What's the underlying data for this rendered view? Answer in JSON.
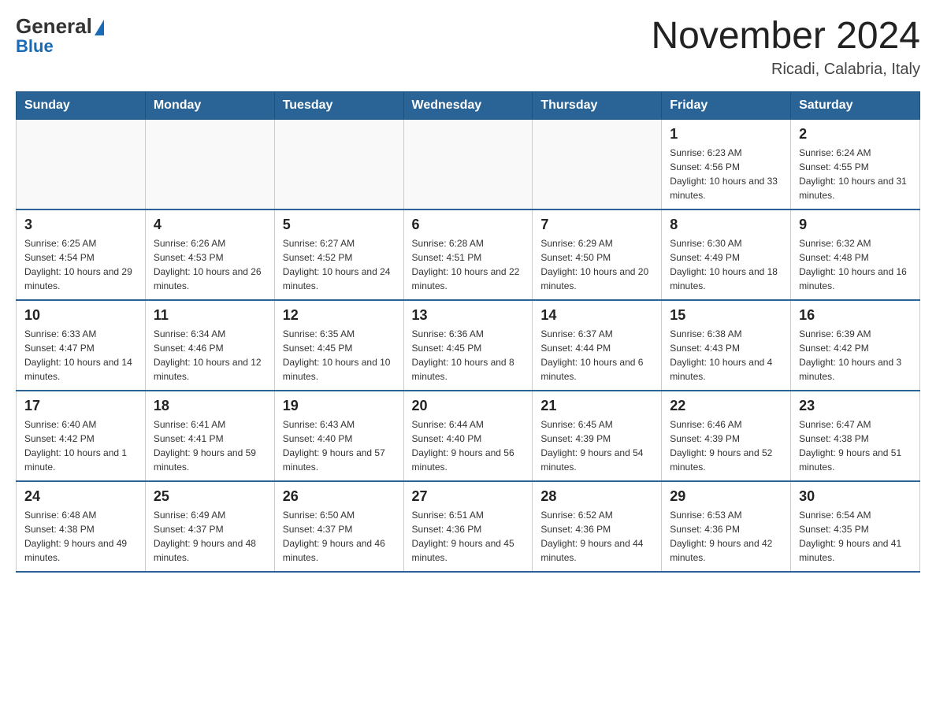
{
  "header": {
    "logo": {
      "general": "General",
      "triangle": "▶",
      "blue": "Blue"
    },
    "title": "November 2024",
    "location": "Ricadi, Calabria, Italy"
  },
  "days_of_week": [
    "Sunday",
    "Monday",
    "Tuesday",
    "Wednesday",
    "Thursday",
    "Friday",
    "Saturday"
  ],
  "weeks": [
    {
      "days": [
        {
          "num": "",
          "info": ""
        },
        {
          "num": "",
          "info": ""
        },
        {
          "num": "",
          "info": ""
        },
        {
          "num": "",
          "info": ""
        },
        {
          "num": "",
          "info": ""
        },
        {
          "num": "1",
          "info": "Sunrise: 6:23 AM\nSunset: 4:56 PM\nDaylight: 10 hours and 33 minutes."
        },
        {
          "num": "2",
          "info": "Sunrise: 6:24 AM\nSunset: 4:55 PM\nDaylight: 10 hours and 31 minutes."
        }
      ]
    },
    {
      "days": [
        {
          "num": "3",
          "info": "Sunrise: 6:25 AM\nSunset: 4:54 PM\nDaylight: 10 hours and 29 minutes."
        },
        {
          "num": "4",
          "info": "Sunrise: 6:26 AM\nSunset: 4:53 PM\nDaylight: 10 hours and 26 minutes."
        },
        {
          "num": "5",
          "info": "Sunrise: 6:27 AM\nSunset: 4:52 PM\nDaylight: 10 hours and 24 minutes."
        },
        {
          "num": "6",
          "info": "Sunrise: 6:28 AM\nSunset: 4:51 PM\nDaylight: 10 hours and 22 minutes."
        },
        {
          "num": "7",
          "info": "Sunrise: 6:29 AM\nSunset: 4:50 PM\nDaylight: 10 hours and 20 minutes."
        },
        {
          "num": "8",
          "info": "Sunrise: 6:30 AM\nSunset: 4:49 PM\nDaylight: 10 hours and 18 minutes."
        },
        {
          "num": "9",
          "info": "Sunrise: 6:32 AM\nSunset: 4:48 PM\nDaylight: 10 hours and 16 minutes."
        }
      ]
    },
    {
      "days": [
        {
          "num": "10",
          "info": "Sunrise: 6:33 AM\nSunset: 4:47 PM\nDaylight: 10 hours and 14 minutes."
        },
        {
          "num": "11",
          "info": "Sunrise: 6:34 AM\nSunset: 4:46 PM\nDaylight: 10 hours and 12 minutes."
        },
        {
          "num": "12",
          "info": "Sunrise: 6:35 AM\nSunset: 4:45 PM\nDaylight: 10 hours and 10 minutes."
        },
        {
          "num": "13",
          "info": "Sunrise: 6:36 AM\nSunset: 4:45 PM\nDaylight: 10 hours and 8 minutes."
        },
        {
          "num": "14",
          "info": "Sunrise: 6:37 AM\nSunset: 4:44 PM\nDaylight: 10 hours and 6 minutes."
        },
        {
          "num": "15",
          "info": "Sunrise: 6:38 AM\nSunset: 4:43 PM\nDaylight: 10 hours and 4 minutes."
        },
        {
          "num": "16",
          "info": "Sunrise: 6:39 AM\nSunset: 4:42 PM\nDaylight: 10 hours and 3 minutes."
        }
      ]
    },
    {
      "days": [
        {
          "num": "17",
          "info": "Sunrise: 6:40 AM\nSunset: 4:42 PM\nDaylight: 10 hours and 1 minute."
        },
        {
          "num": "18",
          "info": "Sunrise: 6:41 AM\nSunset: 4:41 PM\nDaylight: 9 hours and 59 minutes."
        },
        {
          "num": "19",
          "info": "Sunrise: 6:43 AM\nSunset: 4:40 PM\nDaylight: 9 hours and 57 minutes."
        },
        {
          "num": "20",
          "info": "Sunrise: 6:44 AM\nSunset: 4:40 PM\nDaylight: 9 hours and 56 minutes."
        },
        {
          "num": "21",
          "info": "Sunrise: 6:45 AM\nSunset: 4:39 PM\nDaylight: 9 hours and 54 minutes."
        },
        {
          "num": "22",
          "info": "Sunrise: 6:46 AM\nSunset: 4:39 PM\nDaylight: 9 hours and 52 minutes."
        },
        {
          "num": "23",
          "info": "Sunrise: 6:47 AM\nSunset: 4:38 PM\nDaylight: 9 hours and 51 minutes."
        }
      ]
    },
    {
      "days": [
        {
          "num": "24",
          "info": "Sunrise: 6:48 AM\nSunset: 4:38 PM\nDaylight: 9 hours and 49 minutes."
        },
        {
          "num": "25",
          "info": "Sunrise: 6:49 AM\nSunset: 4:37 PM\nDaylight: 9 hours and 48 minutes."
        },
        {
          "num": "26",
          "info": "Sunrise: 6:50 AM\nSunset: 4:37 PM\nDaylight: 9 hours and 46 minutes."
        },
        {
          "num": "27",
          "info": "Sunrise: 6:51 AM\nSunset: 4:36 PM\nDaylight: 9 hours and 45 minutes."
        },
        {
          "num": "28",
          "info": "Sunrise: 6:52 AM\nSunset: 4:36 PM\nDaylight: 9 hours and 44 minutes."
        },
        {
          "num": "29",
          "info": "Sunrise: 6:53 AM\nSunset: 4:36 PM\nDaylight: 9 hours and 42 minutes."
        },
        {
          "num": "30",
          "info": "Sunrise: 6:54 AM\nSunset: 4:35 PM\nDaylight: 9 hours and 41 minutes."
        }
      ]
    }
  ]
}
